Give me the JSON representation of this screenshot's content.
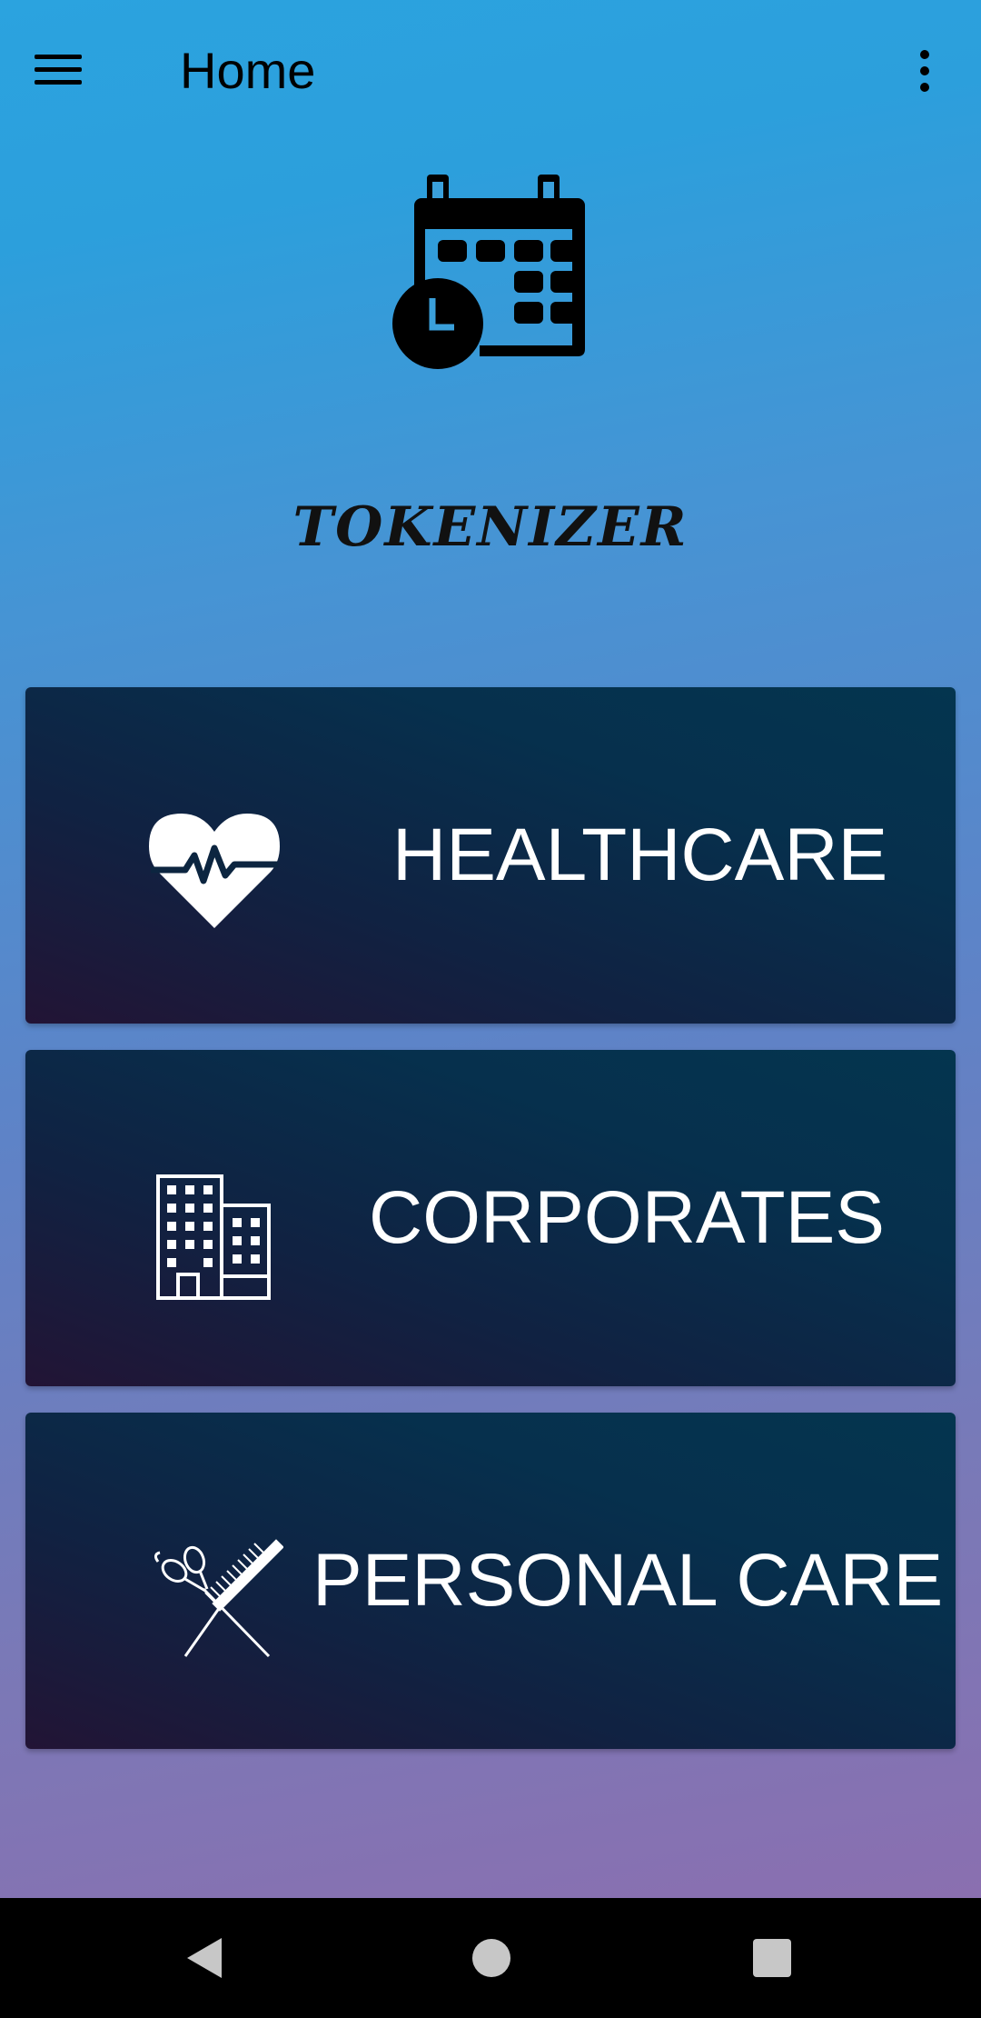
{
  "appbar": {
    "menu_icon": "hamburger-menu-icon",
    "title": "Home",
    "overflow_icon": "more-vert-icon"
  },
  "logo": {
    "icon": "calendar-clock-icon",
    "brand_text": "TOKENIZER"
  },
  "categories": [
    {
      "label": "HEALTHCARE",
      "icon": "heart-pulse-icon"
    },
    {
      "label": "CORPORATES",
      "icon": "office-building-icon"
    },
    {
      "label": "PERSONAL CARE",
      "icon": "scissors-comb-icon"
    }
  ],
  "navbar": {
    "back_icon": "back-triangle-icon",
    "home_icon": "home-circle-icon",
    "recents_icon": "recents-square-icon"
  },
  "colors": {
    "gradient_top": "#2ba3df",
    "gradient_bottom": "#8a6fb0",
    "card_dark": "#102242",
    "card_teal": "#04354f",
    "card_text": "#ffffff"
  }
}
